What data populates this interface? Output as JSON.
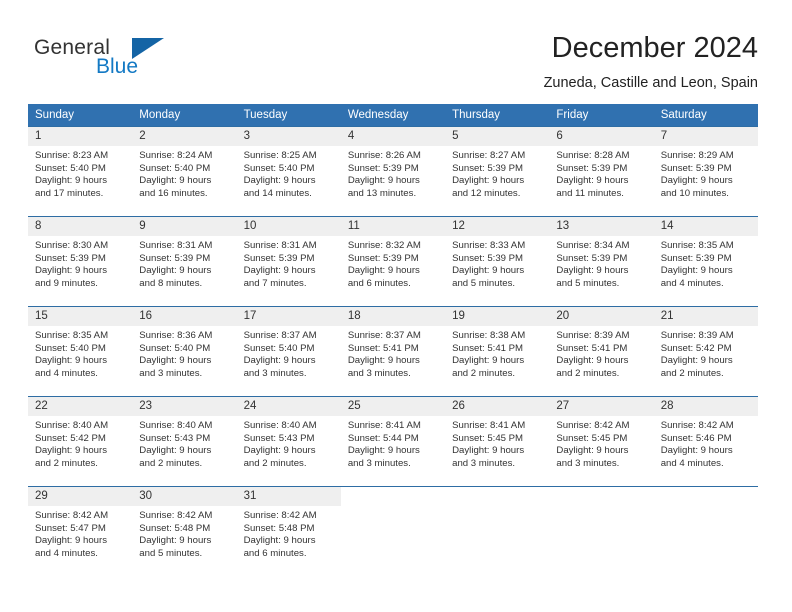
{
  "brand": {
    "word1": "General",
    "word2": "Blue",
    "logo_icon": "blue-triangle-icon",
    "accent_color": "#1379c4"
  },
  "header": {
    "title": "December 2024",
    "subtitle": "Zuneda, Castille and Leon, Spain"
  },
  "theme": {
    "header_row_bg": "#3071b0",
    "daynum_bg": "#efefef",
    "grid_line": "#2e6da4",
    "text": "#333333"
  },
  "weekday_headers": [
    "Sunday",
    "Monday",
    "Tuesday",
    "Wednesday",
    "Thursday",
    "Friday",
    "Saturday"
  ],
  "weeks": [
    [
      {
        "day": "1",
        "sunrise": "Sunrise: 8:23 AM",
        "sunset": "Sunset: 5:40 PM",
        "daylight1": "Daylight: 9 hours",
        "daylight2": "and 17 minutes."
      },
      {
        "day": "2",
        "sunrise": "Sunrise: 8:24 AM",
        "sunset": "Sunset: 5:40 PM",
        "daylight1": "Daylight: 9 hours",
        "daylight2": "and 16 minutes."
      },
      {
        "day": "3",
        "sunrise": "Sunrise: 8:25 AM",
        "sunset": "Sunset: 5:40 PM",
        "daylight1": "Daylight: 9 hours",
        "daylight2": "and 14 minutes."
      },
      {
        "day": "4",
        "sunrise": "Sunrise: 8:26 AM",
        "sunset": "Sunset: 5:39 PM",
        "daylight1": "Daylight: 9 hours",
        "daylight2": "and 13 minutes."
      },
      {
        "day": "5",
        "sunrise": "Sunrise: 8:27 AM",
        "sunset": "Sunset: 5:39 PM",
        "daylight1": "Daylight: 9 hours",
        "daylight2": "and 12 minutes."
      },
      {
        "day": "6",
        "sunrise": "Sunrise: 8:28 AM",
        "sunset": "Sunset: 5:39 PM",
        "daylight1": "Daylight: 9 hours",
        "daylight2": "and 11 minutes."
      },
      {
        "day": "7",
        "sunrise": "Sunrise: 8:29 AM",
        "sunset": "Sunset: 5:39 PM",
        "daylight1": "Daylight: 9 hours",
        "daylight2": "and 10 minutes."
      }
    ],
    [
      {
        "day": "8",
        "sunrise": "Sunrise: 8:30 AM",
        "sunset": "Sunset: 5:39 PM",
        "daylight1": "Daylight: 9 hours",
        "daylight2": "and 9 minutes."
      },
      {
        "day": "9",
        "sunrise": "Sunrise: 8:31 AM",
        "sunset": "Sunset: 5:39 PM",
        "daylight1": "Daylight: 9 hours",
        "daylight2": "and 8 minutes."
      },
      {
        "day": "10",
        "sunrise": "Sunrise: 8:31 AM",
        "sunset": "Sunset: 5:39 PM",
        "daylight1": "Daylight: 9 hours",
        "daylight2": "and 7 minutes."
      },
      {
        "day": "11",
        "sunrise": "Sunrise: 8:32 AM",
        "sunset": "Sunset: 5:39 PM",
        "daylight1": "Daylight: 9 hours",
        "daylight2": "and 6 minutes."
      },
      {
        "day": "12",
        "sunrise": "Sunrise: 8:33 AM",
        "sunset": "Sunset: 5:39 PM",
        "daylight1": "Daylight: 9 hours",
        "daylight2": "and 5 minutes."
      },
      {
        "day": "13",
        "sunrise": "Sunrise: 8:34 AM",
        "sunset": "Sunset: 5:39 PM",
        "daylight1": "Daylight: 9 hours",
        "daylight2": "and 5 minutes."
      },
      {
        "day": "14",
        "sunrise": "Sunrise: 8:35 AM",
        "sunset": "Sunset: 5:39 PM",
        "daylight1": "Daylight: 9 hours",
        "daylight2": "and 4 minutes."
      }
    ],
    [
      {
        "day": "15",
        "sunrise": "Sunrise: 8:35 AM",
        "sunset": "Sunset: 5:40 PM",
        "daylight1": "Daylight: 9 hours",
        "daylight2": "and 4 minutes."
      },
      {
        "day": "16",
        "sunrise": "Sunrise: 8:36 AM",
        "sunset": "Sunset: 5:40 PM",
        "daylight1": "Daylight: 9 hours",
        "daylight2": "and 3 minutes."
      },
      {
        "day": "17",
        "sunrise": "Sunrise: 8:37 AM",
        "sunset": "Sunset: 5:40 PM",
        "daylight1": "Daylight: 9 hours",
        "daylight2": "and 3 minutes."
      },
      {
        "day": "18",
        "sunrise": "Sunrise: 8:37 AM",
        "sunset": "Sunset: 5:41 PM",
        "daylight1": "Daylight: 9 hours",
        "daylight2": "and 3 minutes."
      },
      {
        "day": "19",
        "sunrise": "Sunrise: 8:38 AM",
        "sunset": "Sunset: 5:41 PM",
        "daylight1": "Daylight: 9 hours",
        "daylight2": "and 2 minutes."
      },
      {
        "day": "20",
        "sunrise": "Sunrise: 8:39 AM",
        "sunset": "Sunset: 5:41 PM",
        "daylight1": "Daylight: 9 hours",
        "daylight2": "and 2 minutes."
      },
      {
        "day": "21",
        "sunrise": "Sunrise: 8:39 AM",
        "sunset": "Sunset: 5:42 PM",
        "daylight1": "Daylight: 9 hours",
        "daylight2": "and 2 minutes."
      }
    ],
    [
      {
        "day": "22",
        "sunrise": "Sunrise: 8:40 AM",
        "sunset": "Sunset: 5:42 PM",
        "daylight1": "Daylight: 9 hours",
        "daylight2": "and 2 minutes."
      },
      {
        "day": "23",
        "sunrise": "Sunrise: 8:40 AM",
        "sunset": "Sunset: 5:43 PM",
        "daylight1": "Daylight: 9 hours",
        "daylight2": "and 2 minutes."
      },
      {
        "day": "24",
        "sunrise": "Sunrise: 8:40 AM",
        "sunset": "Sunset: 5:43 PM",
        "daylight1": "Daylight: 9 hours",
        "daylight2": "and 2 minutes."
      },
      {
        "day": "25",
        "sunrise": "Sunrise: 8:41 AM",
        "sunset": "Sunset: 5:44 PM",
        "daylight1": "Daylight: 9 hours",
        "daylight2": "and 3 minutes."
      },
      {
        "day": "26",
        "sunrise": "Sunrise: 8:41 AM",
        "sunset": "Sunset: 5:45 PM",
        "daylight1": "Daylight: 9 hours",
        "daylight2": "and 3 minutes."
      },
      {
        "day": "27",
        "sunrise": "Sunrise: 8:42 AM",
        "sunset": "Sunset: 5:45 PM",
        "daylight1": "Daylight: 9 hours",
        "daylight2": "and 3 minutes."
      },
      {
        "day": "28",
        "sunrise": "Sunrise: 8:42 AM",
        "sunset": "Sunset: 5:46 PM",
        "daylight1": "Daylight: 9 hours",
        "daylight2": "and 4 minutes."
      }
    ],
    [
      {
        "day": "29",
        "sunrise": "Sunrise: 8:42 AM",
        "sunset": "Sunset: 5:47 PM",
        "daylight1": "Daylight: 9 hours",
        "daylight2": "and 4 minutes."
      },
      {
        "day": "30",
        "sunrise": "Sunrise: 8:42 AM",
        "sunset": "Sunset: 5:48 PM",
        "daylight1": "Daylight: 9 hours",
        "daylight2": "and 5 minutes."
      },
      {
        "day": "31",
        "sunrise": "Sunrise: 8:42 AM",
        "sunset": "Sunset: 5:48 PM",
        "daylight1": "Daylight: 9 hours",
        "daylight2": "and 6 minutes."
      },
      {
        "day": "",
        "sunrise": "",
        "sunset": "",
        "daylight1": "",
        "daylight2": ""
      },
      {
        "day": "",
        "sunrise": "",
        "sunset": "",
        "daylight1": "",
        "daylight2": ""
      },
      {
        "day": "",
        "sunrise": "",
        "sunset": "",
        "daylight1": "",
        "daylight2": ""
      },
      {
        "day": "",
        "sunrise": "",
        "sunset": "",
        "daylight1": "",
        "daylight2": ""
      }
    ]
  ]
}
